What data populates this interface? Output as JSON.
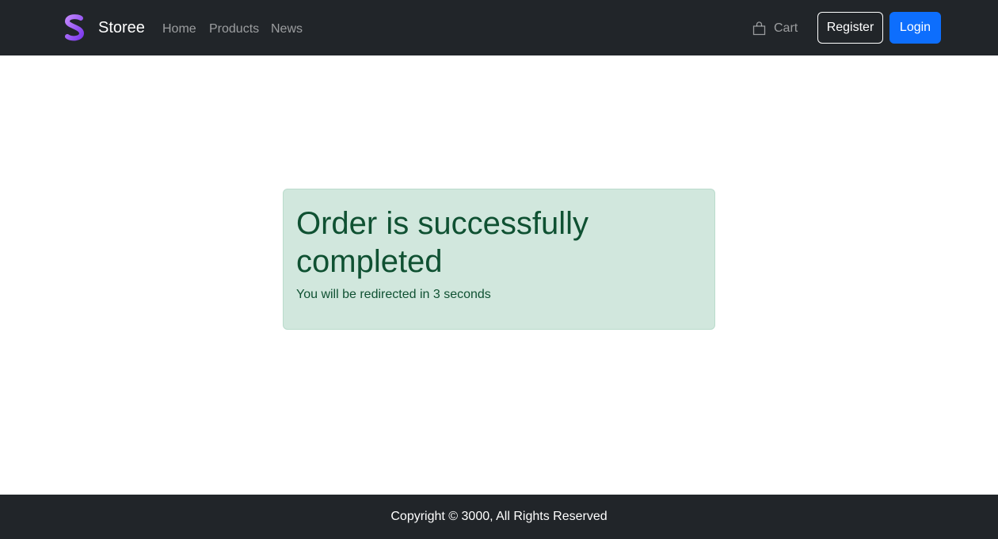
{
  "navbar": {
    "brand": "Storee",
    "logo_icon": "s-logo-icon",
    "links": {
      "home": "Home",
      "products": "Products",
      "news": "News"
    },
    "cart": {
      "icon": "shopping-bag-icon",
      "label": "Cart"
    },
    "register_label": "Register",
    "login_label": "Login"
  },
  "alert": {
    "heading": "Order is successfully completed",
    "message": "You will be redirected in 3 seconds"
  },
  "footer": {
    "copyright": "Copyright © 3000, All Rights Reserved"
  },
  "colors": {
    "navbar_bg": "#212529",
    "primary": "#0d6efd",
    "success_bg": "#d1e7dd",
    "success_text": "#0f5132",
    "logo_gradient_start": "#a855f7",
    "logo_gradient_end": "#7c3aed"
  }
}
